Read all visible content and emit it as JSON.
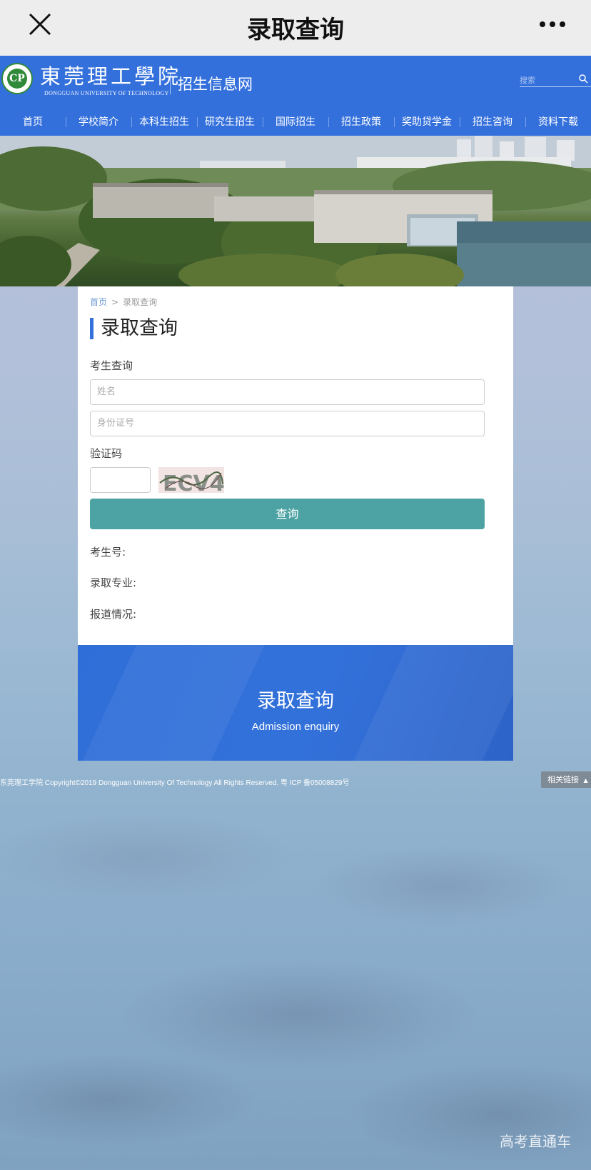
{
  "wechat_bar": {
    "title": "录取查询"
  },
  "site_header": {
    "logo_text": "CP",
    "school_name": "東莞理工學院",
    "school_name_en": "DONGGUAN UNIVERSITY OF TECHNOLOGY",
    "site_subtitle": "招生信息网",
    "search_placeholder": "搜索"
  },
  "nav": {
    "items": [
      "首页",
      "学校简介",
      "本科生招生",
      "研究生招生",
      "国际招生",
      "招生政策",
      "奖助贷学金",
      "招生咨询",
      "资料下载"
    ]
  },
  "breadcrumb": {
    "home": "首页",
    "separator": ">",
    "current": "录取查询"
  },
  "form": {
    "page_title": "录取查询",
    "section_label": "考生查询",
    "name_placeholder": "姓名",
    "id_placeholder": "身份证号",
    "captcha_label": "验证码",
    "captcha_text": "ECV4",
    "query_button": "查询"
  },
  "results": {
    "candidate_no": "考生号:",
    "major": "录取专业:",
    "report_status": "报道情况:"
  },
  "blue_block": {
    "title": "录取查询",
    "subtitle": "Admission enquiry"
  },
  "footer": {
    "copyright": "东莞理工学院 Copyright©2019 Dongguan University Of Technology All Rights Reserved. 粤 ICP 备05008829号",
    "related_links": "相关链接"
  },
  "watermark": "高考直通车",
  "colors": {
    "brand_blue": "#3470dc",
    "button_teal": "#4da3a3",
    "page_bg": "#b3c0da"
  }
}
